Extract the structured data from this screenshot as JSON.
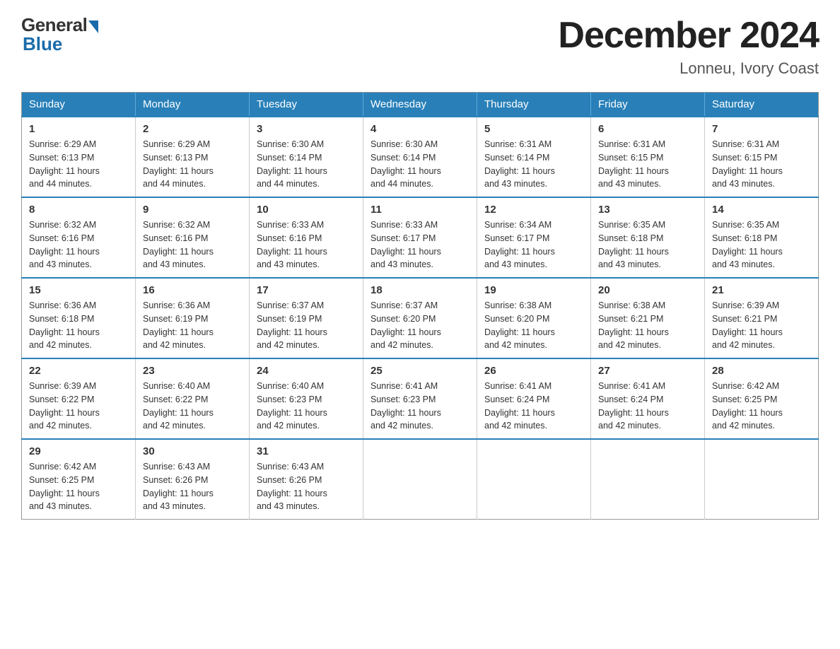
{
  "logo": {
    "general": "General",
    "blue": "Blue"
  },
  "title": "December 2024",
  "location": "Lonneu, Ivory Coast",
  "days_of_week": [
    "Sunday",
    "Monday",
    "Tuesday",
    "Wednesday",
    "Thursday",
    "Friday",
    "Saturday"
  ],
  "weeks": [
    [
      {
        "day": "1",
        "sunrise": "6:29 AM",
        "sunset": "6:13 PM",
        "daylight": "11 hours and 44 minutes."
      },
      {
        "day": "2",
        "sunrise": "6:29 AM",
        "sunset": "6:13 PM",
        "daylight": "11 hours and 44 minutes."
      },
      {
        "day": "3",
        "sunrise": "6:30 AM",
        "sunset": "6:14 PM",
        "daylight": "11 hours and 44 minutes."
      },
      {
        "day": "4",
        "sunrise": "6:30 AM",
        "sunset": "6:14 PM",
        "daylight": "11 hours and 44 minutes."
      },
      {
        "day": "5",
        "sunrise": "6:31 AM",
        "sunset": "6:14 PM",
        "daylight": "11 hours and 43 minutes."
      },
      {
        "day": "6",
        "sunrise": "6:31 AM",
        "sunset": "6:15 PM",
        "daylight": "11 hours and 43 minutes."
      },
      {
        "day": "7",
        "sunrise": "6:31 AM",
        "sunset": "6:15 PM",
        "daylight": "11 hours and 43 minutes."
      }
    ],
    [
      {
        "day": "8",
        "sunrise": "6:32 AM",
        "sunset": "6:16 PM",
        "daylight": "11 hours and 43 minutes."
      },
      {
        "day": "9",
        "sunrise": "6:32 AM",
        "sunset": "6:16 PM",
        "daylight": "11 hours and 43 minutes."
      },
      {
        "day": "10",
        "sunrise": "6:33 AM",
        "sunset": "6:16 PM",
        "daylight": "11 hours and 43 minutes."
      },
      {
        "day": "11",
        "sunrise": "6:33 AM",
        "sunset": "6:17 PM",
        "daylight": "11 hours and 43 minutes."
      },
      {
        "day": "12",
        "sunrise": "6:34 AM",
        "sunset": "6:17 PM",
        "daylight": "11 hours and 43 minutes."
      },
      {
        "day": "13",
        "sunrise": "6:35 AM",
        "sunset": "6:18 PM",
        "daylight": "11 hours and 43 minutes."
      },
      {
        "day": "14",
        "sunrise": "6:35 AM",
        "sunset": "6:18 PM",
        "daylight": "11 hours and 43 minutes."
      }
    ],
    [
      {
        "day": "15",
        "sunrise": "6:36 AM",
        "sunset": "6:18 PM",
        "daylight": "11 hours and 42 minutes."
      },
      {
        "day": "16",
        "sunrise": "6:36 AM",
        "sunset": "6:19 PM",
        "daylight": "11 hours and 42 minutes."
      },
      {
        "day": "17",
        "sunrise": "6:37 AM",
        "sunset": "6:19 PM",
        "daylight": "11 hours and 42 minutes."
      },
      {
        "day": "18",
        "sunrise": "6:37 AM",
        "sunset": "6:20 PM",
        "daylight": "11 hours and 42 minutes."
      },
      {
        "day": "19",
        "sunrise": "6:38 AM",
        "sunset": "6:20 PM",
        "daylight": "11 hours and 42 minutes."
      },
      {
        "day": "20",
        "sunrise": "6:38 AM",
        "sunset": "6:21 PM",
        "daylight": "11 hours and 42 minutes."
      },
      {
        "day": "21",
        "sunrise": "6:39 AM",
        "sunset": "6:21 PM",
        "daylight": "11 hours and 42 minutes."
      }
    ],
    [
      {
        "day": "22",
        "sunrise": "6:39 AM",
        "sunset": "6:22 PM",
        "daylight": "11 hours and 42 minutes."
      },
      {
        "day": "23",
        "sunrise": "6:40 AM",
        "sunset": "6:22 PM",
        "daylight": "11 hours and 42 minutes."
      },
      {
        "day": "24",
        "sunrise": "6:40 AM",
        "sunset": "6:23 PM",
        "daylight": "11 hours and 42 minutes."
      },
      {
        "day": "25",
        "sunrise": "6:41 AM",
        "sunset": "6:23 PM",
        "daylight": "11 hours and 42 minutes."
      },
      {
        "day": "26",
        "sunrise": "6:41 AM",
        "sunset": "6:24 PM",
        "daylight": "11 hours and 42 minutes."
      },
      {
        "day": "27",
        "sunrise": "6:41 AM",
        "sunset": "6:24 PM",
        "daylight": "11 hours and 42 minutes."
      },
      {
        "day": "28",
        "sunrise": "6:42 AM",
        "sunset": "6:25 PM",
        "daylight": "11 hours and 42 minutes."
      }
    ],
    [
      {
        "day": "29",
        "sunrise": "6:42 AM",
        "sunset": "6:25 PM",
        "daylight": "11 hours and 43 minutes."
      },
      {
        "day": "30",
        "sunrise": "6:43 AM",
        "sunset": "6:26 PM",
        "daylight": "11 hours and 43 minutes."
      },
      {
        "day": "31",
        "sunrise": "6:43 AM",
        "sunset": "6:26 PM",
        "daylight": "11 hours and 43 minutes."
      },
      null,
      null,
      null,
      null
    ]
  ],
  "labels": {
    "sunrise": "Sunrise:",
    "sunset": "Sunset:",
    "daylight": "Daylight:"
  }
}
